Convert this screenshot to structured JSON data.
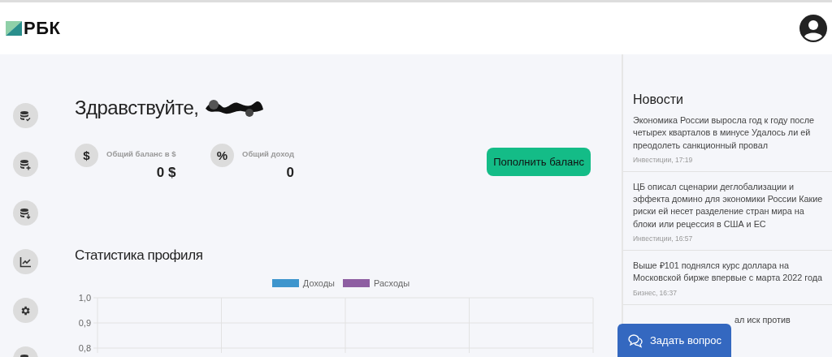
{
  "header": {
    "logo": "РБК"
  },
  "sidebar": {
    "items": [
      {
        "kind": "coins-check"
      },
      {
        "kind": "coins-plus"
      },
      {
        "kind": "coins-down"
      },
      {
        "kind": "chart"
      },
      {
        "kind": "gear"
      },
      {
        "kind": "coins"
      }
    ]
  },
  "greeting": "Здравствуйте,",
  "stats": [
    {
      "icon": "$",
      "label": "Общий баланс в $",
      "value": "0 $"
    },
    {
      "icon": "%",
      "label": "Общий доход",
      "value": "0"
    }
  ],
  "topup_button": "Пополнить баланс",
  "statistics": {
    "title": "Статистика профиля",
    "chart_data": {
      "type": "line",
      "series": [
        {
          "name": "Доходы",
          "color": "#3e95cd"
        },
        {
          "name": "Расходы",
          "color": "#8e5ea2"
        }
      ],
      "ylim": [
        0.8,
        1.0
      ],
      "yticks": [
        {
          "value": 1.0,
          "label": "1,0"
        },
        {
          "value": 0.9,
          "label": "0,9"
        },
        {
          "value": 0.8,
          "label": "0,8"
        }
      ]
    }
  },
  "news": {
    "title": "Новости",
    "items": [
      {
        "title": "Экономика России выросла год к году после четырех кварталов в минусе Удалось ли ей преодолеть санкционный провал",
        "meta": "Инвестиции, 17:19"
      },
      {
        "title": "ЦБ описал сценарии деглобализации и эффекта домино для экономики России Какие риски ей несет разделение стран мира на блоки или рецессия в США и ЕС",
        "meta": "Инвестиции, 16:57"
      },
      {
        "title": "Выше ₽101 поднялся курс доллара на Московской бирже впервые с марта 2022 года",
        "meta": "Бизнес, 16:37"
      },
      {
        "title": "ал иск против",
        "kind": "partial"
      }
    ]
  },
  "chat_button": "Задать вопрос"
}
